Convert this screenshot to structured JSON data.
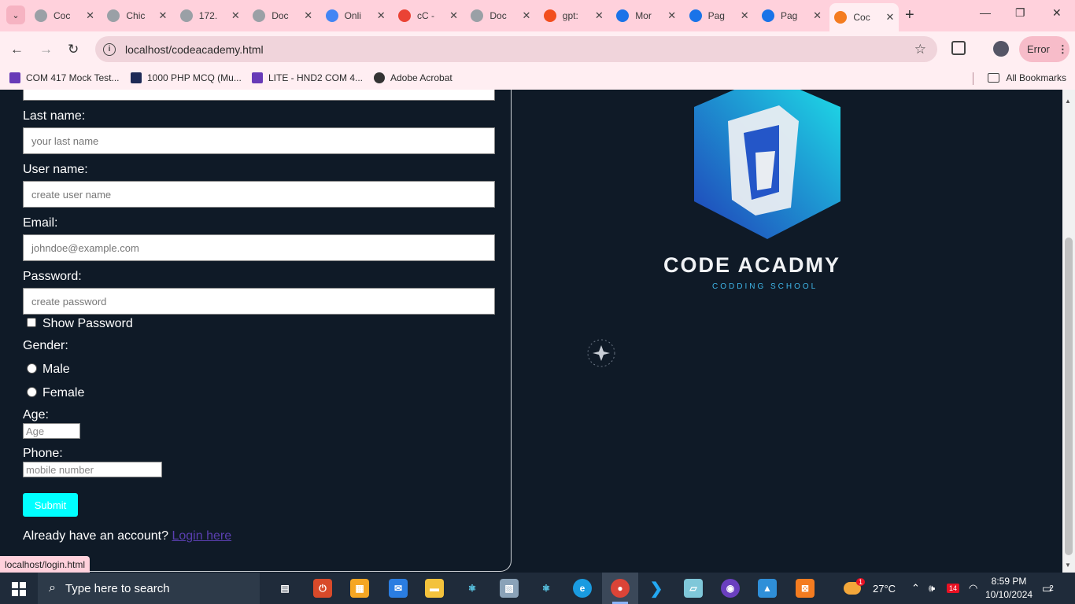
{
  "browser": {
    "tabs": [
      {
        "title": "Coc",
        "color": "#9aa0a6"
      },
      {
        "title": "Chic",
        "color": "#9aa0a6"
      },
      {
        "title": "172.",
        "color": "#9aa0a6"
      },
      {
        "title": "Doc",
        "color": "#9aa0a6"
      },
      {
        "title": "Onli",
        "color": "#4285f4"
      },
      {
        "title": "cC -",
        "color": "#ea4335"
      },
      {
        "title": "Doc",
        "color": "#9aa0a6"
      },
      {
        "title": "gpt:",
        "color": "#f24e1e"
      },
      {
        "title": "Mor",
        "color": "#1a73e8"
      },
      {
        "title": "Pag",
        "color": "#1a73e8"
      },
      {
        "title": "Pag",
        "color": "#1a73e8"
      },
      {
        "title": "Coc",
        "color": "#f47c20"
      }
    ],
    "address": "localhost/codeacademy.html",
    "profile_button": "Error",
    "bookmarks": [
      {
        "label": "COM 417 Mock Test...",
        "color": "#673ab7"
      },
      {
        "label": "1000 PHP MCQ (Mu...",
        "color": "#1e2a56"
      },
      {
        "label": "LITE - HND2 COM 4...",
        "color": "#673ab7"
      },
      {
        "label": "Adobe Acrobat",
        "color": "#333333"
      }
    ],
    "all_bookmarks": "All Bookmarks",
    "status_url": "localhost/login.html"
  },
  "form": {
    "last_name_label": "Last name:",
    "last_name_placeholder": "your last name",
    "user_name_label": "User name:",
    "user_name_placeholder": "create user name",
    "email_label": "Email:",
    "email_placeholder": "johndoe@example.com",
    "password_label": "Password:",
    "password_placeholder": "create password",
    "show_password": "Show Password",
    "gender_label": "Gender:",
    "male": "Male",
    "female": "Female",
    "age_label": "Age:",
    "age_placeholder": "Age",
    "phone_label": "Phone:",
    "phone_placeholder": "mobile number",
    "submit": "Submit",
    "already_text": "Already have an account?",
    "login_link": "Login here",
    "accent_color": "#00ffff"
  },
  "brand": {
    "name": "CODE ACADMY",
    "tagline": "CODDING SCHOOL"
  },
  "taskbar": {
    "search_placeholder": "Type here to search",
    "weather": "27°C",
    "weather_badge": "1",
    "calendar_badge": "14",
    "time": "8:59 PM",
    "date": "10/10/2024",
    "notifications": "2"
  }
}
